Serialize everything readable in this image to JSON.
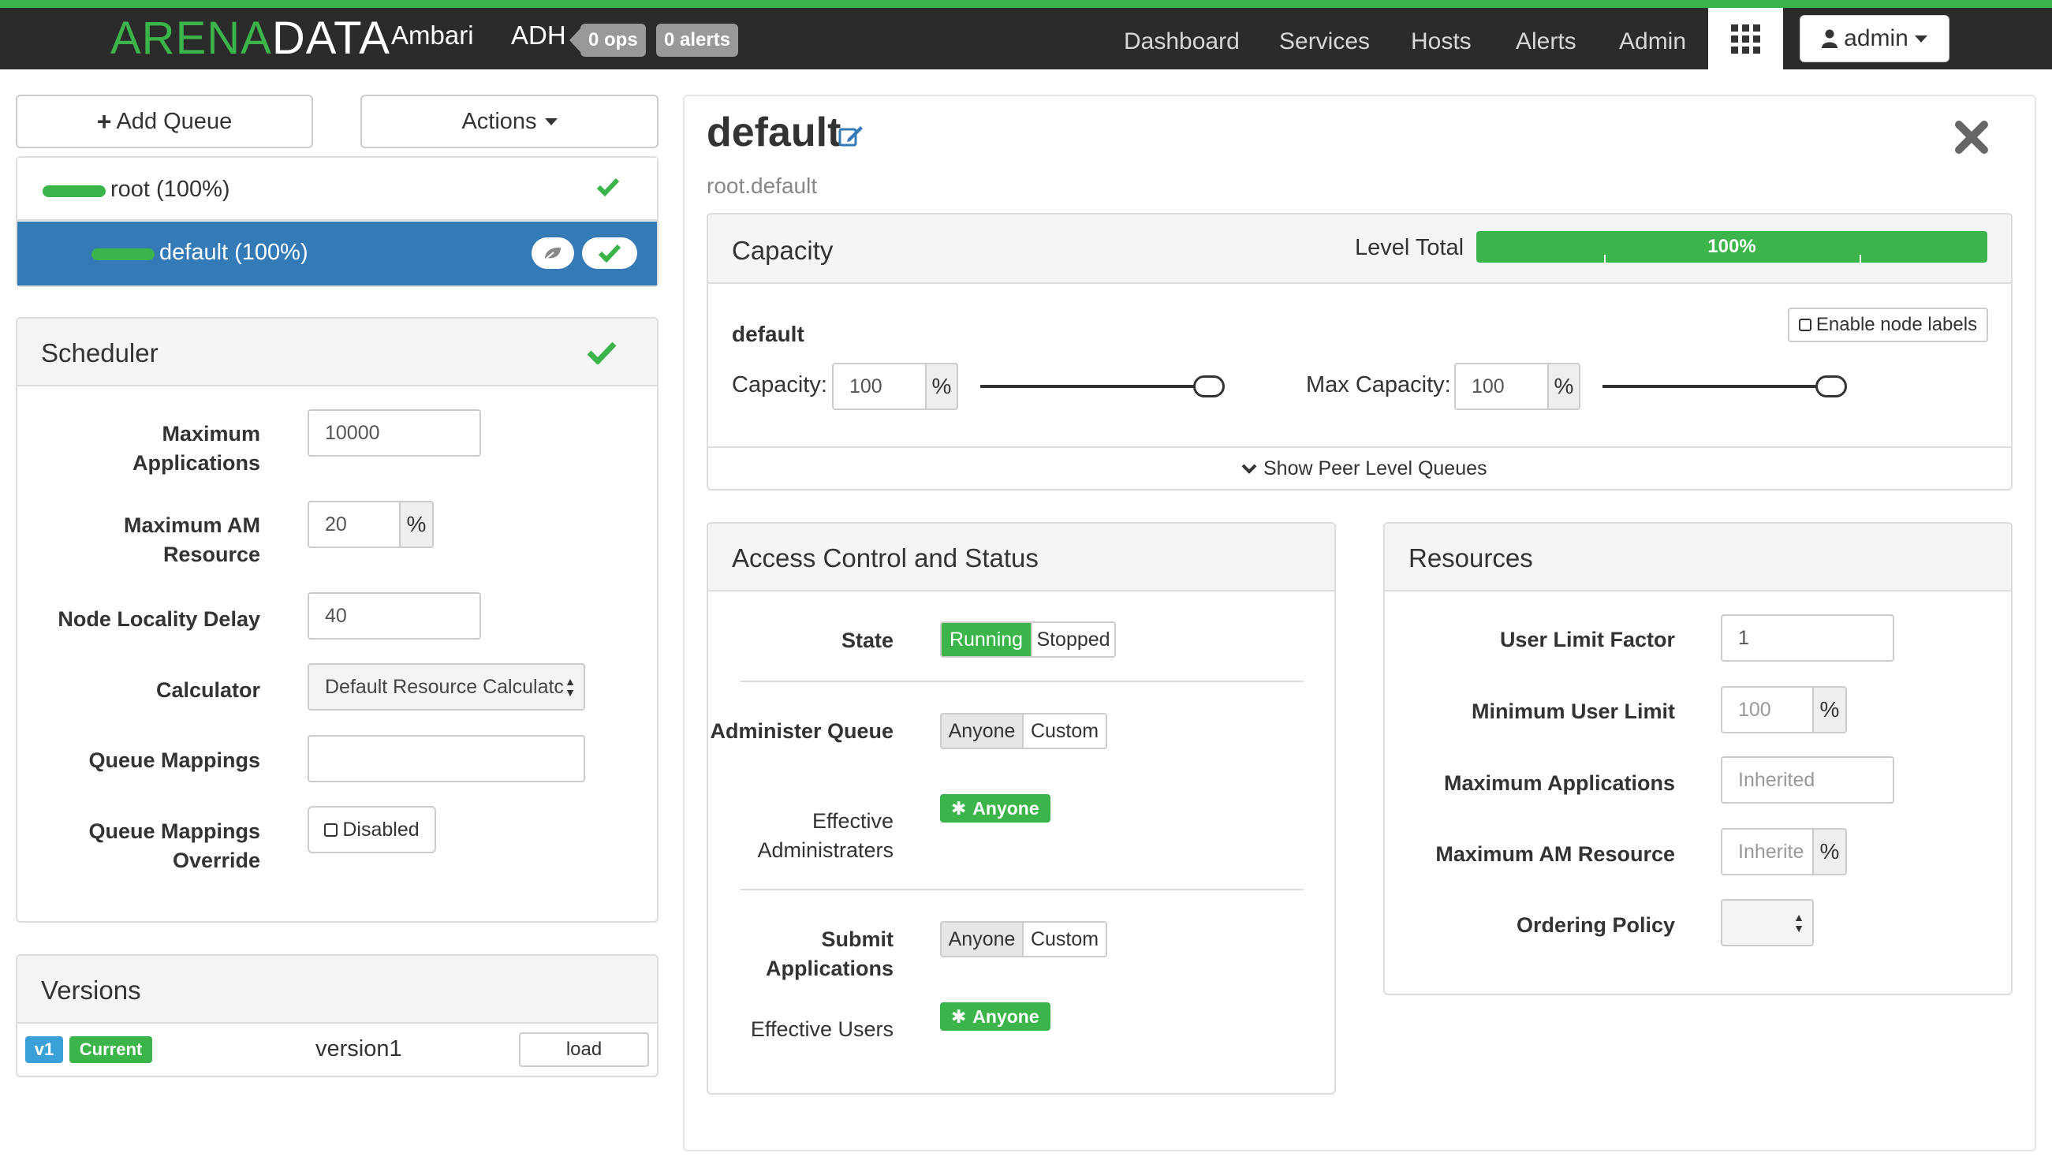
{
  "navbar": {
    "brand_part1": "ARENA",
    "brand_part2": "DATA",
    "app_name": "Ambari",
    "cluster_name": "ADH",
    "ops_badge": "0 ops",
    "alerts_badge": "0 alerts",
    "links": [
      "Dashboard",
      "Services",
      "Hosts",
      "Alerts",
      "Admin"
    ],
    "user": "admin"
  },
  "queue_toolbar": {
    "add_queue": "Add Queue",
    "actions": "Actions"
  },
  "queues": {
    "root": "root (100%)",
    "default": "default (100%)"
  },
  "scheduler": {
    "title": "Scheduler",
    "fields": {
      "max_apps_label": "Maximum Applications",
      "max_apps_value": "10000",
      "max_am_label": "Maximum AM Resource",
      "max_am_value": "20",
      "max_am_unit": "%",
      "locality_label": "Node Locality Delay",
      "locality_value": "40",
      "calculator_label": "Calculator",
      "calculator_value": "Default Resource Calculatc",
      "mappings_label": "Queue Mappings",
      "mappings_value": "",
      "override_label": "Queue Mappings Override",
      "override_value": "Disabled"
    }
  },
  "versions": {
    "title": "Versions",
    "tag": "v1",
    "current": "Current",
    "name": "version1",
    "load": "load"
  },
  "queue_detail": {
    "title": "default",
    "path": "root.default"
  },
  "capacity": {
    "title": "Capacity",
    "level_total_label": "Level Total",
    "level_total_value": "100%",
    "level_total_fraction": 1.0,
    "queue_name": "default",
    "enable_node_labels": "Enable node labels",
    "capacity_label": "Capacity:",
    "capacity_value": "100",
    "capacity_unit": "%",
    "max_capacity_label": "Max Capacity:",
    "max_capacity_value": "100",
    "max_capacity_unit": "%",
    "capacity_slider_fraction": 1.0,
    "max_capacity_slider_fraction": 1.0,
    "peer_link": "Show Peer Level Queues"
  },
  "access": {
    "title": "Access Control and Status",
    "state_label": "State",
    "state_running": "Running",
    "state_stopped": "Stopped",
    "administer_label": "Administer Queue",
    "anyone": "Anyone",
    "custom": "Custom",
    "effective_admins_label": "Effective Administraters",
    "effective_admins_value": "Anyone",
    "submit_label": "Submit Applications",
    "effective_users_label": "Effective Users",
    "effective_users_value": "Anyone"
  },
  "resources": {
    "title": "Resources",
    "user_limit_factor_label": "User Limit Factor",
    "user_limit_factor_value": "1",
    "min_user_limit_label": "Minimum User Limit",
    "min_user_limit_value": "100",
    "min_user_limit_unit": "%",
    "max_apps_label": "Maximum Applications",
    "max_apps_placeholder": "Inherited",
    "max_am_label": "Maximum AM Resource",
    "max_am_placeholder": "Inherite",
    "max_am_unit": "%",
    "ordering_label": "Ordering Policy",
    "ordering_value": ""
  },
  "colors": {
    "brand_green": "#3bb44a",
    "selected_blue": "#337ab7",
    "navbar_bg": "#2b2b2b"
  }
}
